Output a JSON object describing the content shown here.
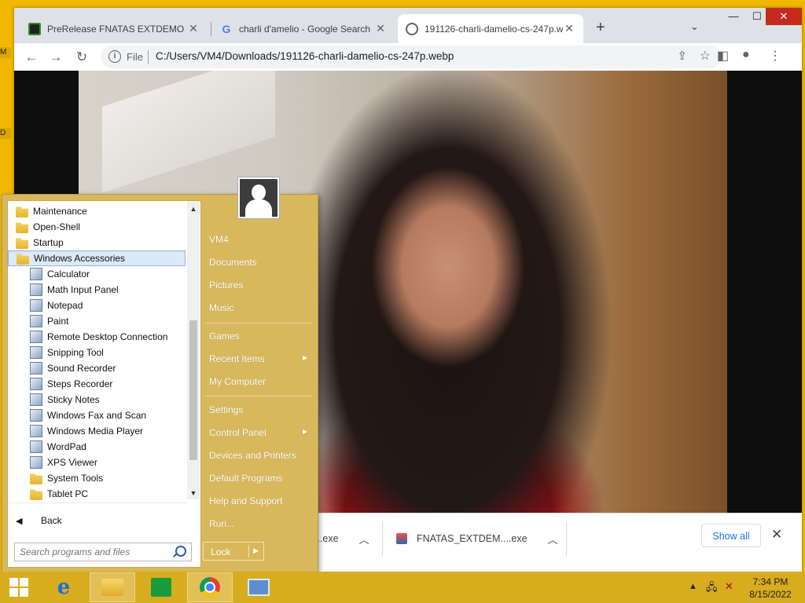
{
  "desktop": {
    "fragment1": "M",
    "fragment2": "D"
  },
  "browser": {
    "tabs": [
      {
        "title": "PreRelease FNATAS EXTDEMO In",
        "active": false
      },
      {
        "title": "charli d'amelio - Google Search",
        "active": false
      },
      {
        "title": "191126-charli-damelio-cs-247p.w",
        "active": true
      }
    ],
    "address": {
      "scheme": "File",
      "url": "C:/Users/VM4/Downloads/191126-charli-damelio-cs-247p.webp"
    },
    "downloads": [
      {
        "name": "...exe"
      },
      {
        "name": "FNATAS_EXTDEM....exe"
      }
    ],
    "show_all": "Show all"
  },
  "start_menu": {
    "programs": [
      {
        "label": "Maintenance",
        "icon": "folder-icon",
        "indent": false,
        "selected": false
      },
      {
        "label": "Open-Shell",
        "icon": "folder-icon",
        "indent": false,
        "selected": false
      },
      {
        "label": "Startup",
        "icon": "folder-icon",
        "indent": false,
        "selected": false
      },
      {
        "label": "Windows Accessories",
        "icon": "folder-icon",
        "indent": false,
        "selected": true
      },
      {
        "label": "Calculator",
        "icon": "calculator-icon",
        "indent": true,
        "selected": false
      },
      {
        "label": "Math Input Panel",
        "icon": "math-input-icon",
        "indent": true,
        "selected": false
      },
      {
        "label": "Notepad",
        "icon": "notepad-icon",
        "indent": true,
        "selected": false
      },
      {
        "label": "Paint",
        "icon": "paint-icon",
        "indent": true,
        "selected": false
      },
      {
        "label": "Remote Desktop Connection",
        "icon": "remote-desktop-icon",
        "indent": true,
        "selected": false
      },
      {
        "label": "Snipping Tool",
        "icon": "snipping-tool-icon",
        "indent": true,
        "selected": false
      },
      {
        "label": "Sound Recorder",
        "icon": "microphone-icon",
        "indent": true,
        "selected": false
      },
      {
        "label": "Steps Recorder",
        "icon": "steps-recorder-icon",
        "indent": true,
        "selected": false
      },
      {
        "label": "Sticky Notes",
        "icon": "sticky-notes-icon",
        "indent": true,
        "selected": false
      },
      {
        "label": "Windows Fax and Scan",
        "icon": "fax-icon",
        "indent": true,
        "selected": false
      },
      {
        "label": "Windows Media Player",
        "icon": "media-player-icon",
        "indent": true,
        "selected": false
      },
      {
        "label": "WordPad",
        "icon": "wordpad-icon",
        "indent": true,
        "selected": false
      },
      {
        "label": "XPS Viewer",
        "icon": "xps-viewer-icon",
        "indent": true,
        "selected": false
      },
      {
        "label": "System Tools",
        "icon": "folder-icon",
        "indent": true,
        "selected": false
      },
      {
        "label": "Tablet PC",
        "icon": "folder-icon",
        "indent": true,
        "selected": false
      }
    ],
    "back": "Back",
    "search_placeholder": "Search programs and files",
    "right_items": [
      {
        "label": "VM4",
        "submenu": false
      },
      {
        "label": "Documents",
        "submenu": false
      },
      {
        "label": "Pictures",
        "submenu": false
      },
      {
        "label": "Music",
        "submenu": false
      },
      {
        "label": "Games",
        "submenu": false
      },
      {
        "label": "Recent Items",
        "submenu": true
      },
      {
        "label": "My Computer",
        "submenu": false
      },
      {
        "label": "Settings",
        "submenu": false
      },
      {
        "label": "Control Panel",
        "submenu": true
      },
      {
        "label": "Devices and Printers",
        "submenu": false
      },
      {
        "label": "Default Programs",
        "submenu": false
      },
      {
        "label": "Help and Support",
        "submenu": false
      },
      {
        "label": "Run...",
        "submenu": false
      }
    ],
    "lock": "Lock"
  },
  "taskbar": {
    "apps": [
      {
        "name": "internet-explorer-icon",
        "active": false
      },
      {
        "name": "file-explorer-icon",
        "active": true
      },
      {
        "name": "store-icon",
        "active": false
      },
      {
        "name": "chrome-icon",
        "active": true
      },
      {
        "name": "control-panel-icon",
        "active": false
      }
    ],
    "time": "7:34 PM",
    "date": "8/15/2022"
  },
  "colors": {
    "taskbar": "#d7ac1f",
    "start_menu": "#d8b85c",
    "desktop": "#f2b800"
  }
}
